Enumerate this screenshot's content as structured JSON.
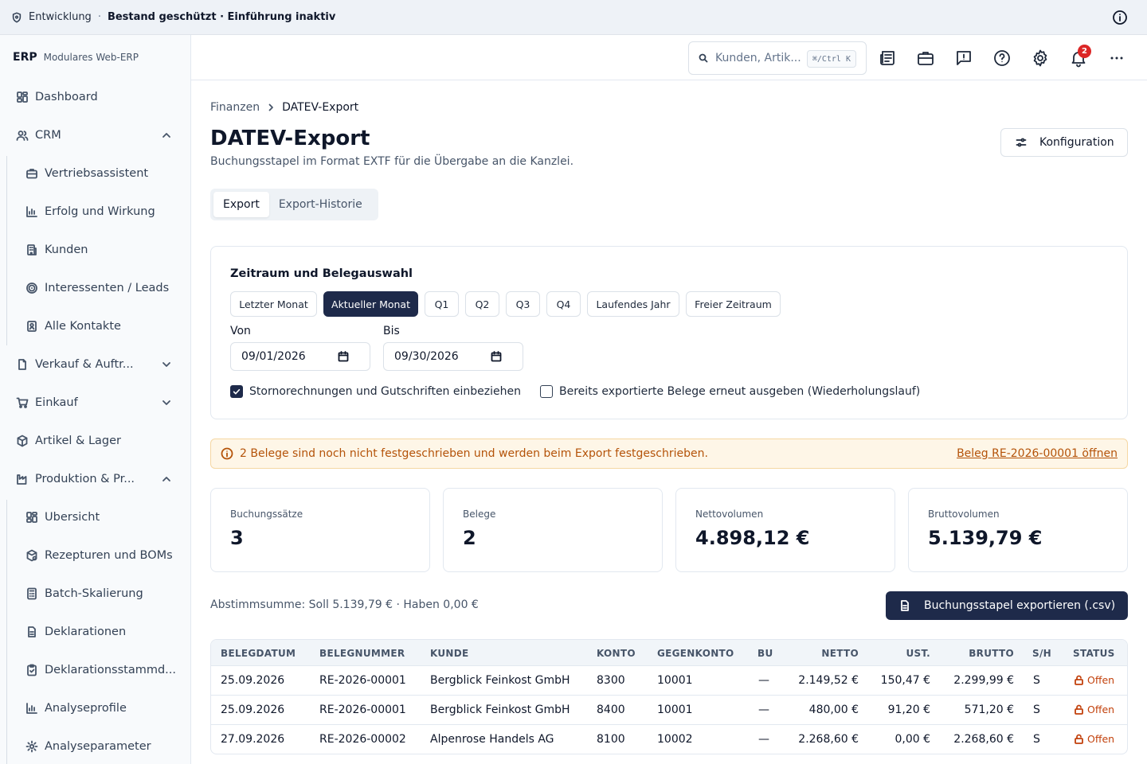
{
  "banner": {
    "environment": "Entwicklung",
    "separator": "·",
    "status": "Bestand geschützt · Einführung inaktiv"
  },
  "brand": {
    "name": "ERP",
    "tagline": "Modulares Web-ERP"
  },
  "sidebar": {
    "items": [
      {
        "label": "Dashboard",
        "icon": "dashboard-icon"
      },
      {
        "label": "CRM",
        "icon": "users-icon",
        "expanded": true
      },
      {
        "label": "Vertriebsassistent",
        "icon": "briefcase-icon"
      },
      {
        "label": "Erfolg und Wirkung",
        "icon": "bar-chart-icon"
      },
      {
        "label": "Kunden",
        "icon": "building-icon"
      },
      {
        "label": "Interessenten / Leads",
        "icon": "target-icon"
      },
      {
        "label": "Alle Kontakte",
        "icon": "contact-icon"
      },
      {
        "label": "Verkauf & Auftr...",
        "icon": "document-icon",
        "expanded": false
      },
      {
        "label": "Einkauf",
        "icon": "cart-icon",
        "expanded": false
      },
      {
        "label": "Artikel & Lager",
        "icon": "package-icon"
      },
      {
        "label": "Produktion & Pr...",
        "icon": "factory-icon",
        "expanded": true
      },
      {
        "label": "Übersicht",
        "icon": "grid-icon"
      },
      {
        "label": "Rezepturen und BOMs",
        "icon": "recipe-icon"
      },
      {
        "label": "Batch-Skalierung",
        "icon": "calculator-icon"
      },
      {
        "label": "Deklarationen",
        "icon": "file-icon"
      },
      {
        "label": "Deklarationsstammd...",
        "icon": "clipboard-icon"
      },
      {
        "label": "Analyseprofile",
        "icon": "bar-chart-icon"
      },
      {
        "label": "Analyseparameter",
        "icon": "gear-icon"
      }
    ]
  },
  "toolbar": {
    "search_placeholder": "Kunden, Artik...",
    "search_shortcut": "⌘/Ctrl K",
    "notification_count": "2"
  },
  "page": {
    "breadcrumb_parent": "Finanzen",
    "breadcrumb_current": "DATEV-Export",
    "title": "DATEV-Export",
    "subtitle": "Buchungsstapel im Format EXTF für die Übergabe an die Kanzlei.",
    "config_button": "Konfiguration",
    "tabs": [
      {
        "label": "Export",
        "active": true
      },
      {
        "label": "Export-Historie",
        "active": false
      }
    ]
  },
  "period": {
    "title": "Zeitraum und Belegauswahl",
    "chips": [
      {
        "label": "Letzter Monat",
        "active": false
      },
      {
        "label": "Aktueller Monat",
        "active": true
      },
      {
        "label": "Q1",
        "active": false
      },
      {
        "label": "Q2",
        "active": false
      },
      {
        "label": "Q3",
        "active": false
      },
      {
        "label": "Q4",
        "active": false
      },
      {
        "label": "Laufendes Jahr",
        "active": false
      },
      {
        "label": "Freier Zeitraum",
        "active": false
      }
    ],
    "from_label": "Von",
    "from_value": "09/01/2026",
    "to_label": "Bis",
    "to_value": "09/30/2026",
    "checkbox_storno": {
      "label": "Stornorechnungen und Gutschriften einbeziehen",
      "checked": true
    },
    "checkbox_repeat": {
      "label": "Bereits exportierte Belege erneut ausgeben (Wiederholungslauf)",
      "checked": false
    }
  },
  "alert": {
    "text": "2 Belege sind noch nicht festgeschrieben und werden beim Export festgeschrieben.",
    "link": "Beleg RE-2026-00001 öffnen"
  },
  "stats": [
    {
      "label": "Buchungssätze",
      "value": "3"
    },
    {
      "label": "Belege",
      "value": "2"
    },
    {
      "label": "Nettovolumen",
      "value": "4.898,12 €"
    },
    {
      "label": "Bruttovolumen",
      "value": "5.139,79 €"
    }
  ],
  "summary": "Abstimmsumme: Soll 5.139,79 € · Haben 0,00 €",
  "export_button": "Buchungsstapel exportieren (.csv)",
  "table": {
    "headers": [
      "BELEGDATUM",
      "BELEGNUMMER",
      "KUNDE",
      "KONTO",
      "GEGENKONTO",
      "BU",
      "NETTO",
      "UST.",
      "BRUTTO",
      "S/H",
      "STATUS"
    ],
    "rows": [
      [
        "25.09.2026",
        "RE-2026-00001",
        "Bergblick Feinkost GmbH",
        "8300",
        "10001",
        "—",
        "2.149,52 €",
        "150,47 €",
        "2.299,99 €",
        "S",
        "Offen"
      ],
      [
        "25.09.2026",
        "RE-2026-00001",
        "Bergblick Feinkost GmbH",
        "8400",
        "10001",
        "—",
        "480,00 €",
        "91,20 €",
        "571,20 €",
        "S",
        "Offen"
      ],
      [
        "27.09.2026",
        "RE-2026-00002",
        "Alpenrose Handels AG",
        "8100",
        "10002",
        "—",
        "2.268,60 €",
        "0,00 €",
        "2.268,60 €",
        "S",
        "Offen"
      ]
    ]
  },
  "colors": {
    "primary": "#1e2a4a",
    "alert_bg": "#fef6e7",
    "alert_text": "#b45309",
    "status_open": "#c2410c",
    "badge": "#dc2626"
  }
}
